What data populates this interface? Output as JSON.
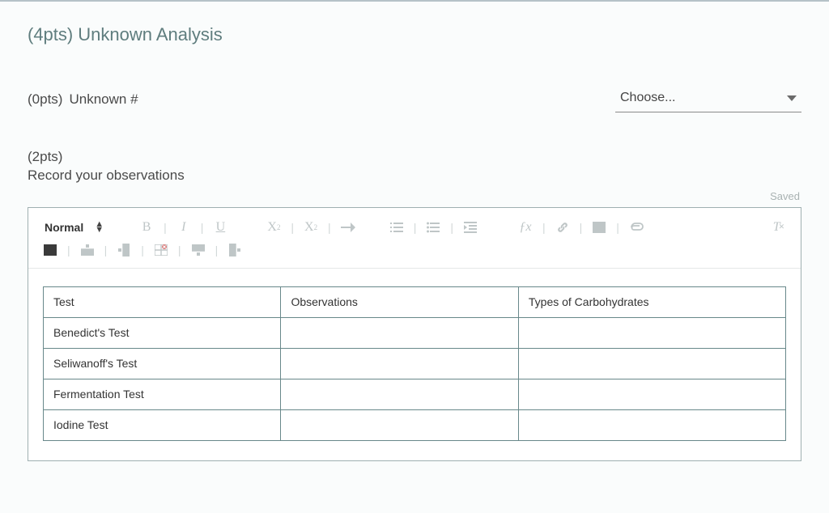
{
  "section": {
    "pts": "(4pts)",
    "title": "Unknown Analysis"
  },
  "q1": {
    "pts": "(0pts)",
    "label": "Unknown #",
    "dropdown_placeholder": "Choose..."
  },
  "q2": {
    "pts": "(2pts)",
    "label": "Record your observations",
    "saved": "Saved"
  },
  "toolbar": {
    "style": "Normal",
    "bold": "B",
    "italic": "I",
    "underline": "U",
    "sub": "X",
    "sup": "X",
    "fx": "ƒx",
    "clear": "T"
  },
  "table": {
    "headers": [
      "Test",
      "Observations",
      "Types of Carbohydrates"
    ],
    "rows": [
      [
        "Benedict's Test",
        "",
        ""
      ],
      [
        "Seliwanoff's Test",
        "",
        ""
      ],
      [
        "Fermentation Test",
        "",
        ""
      ],
      [
        "Iodine Test",
        "",
        ""
      ]
    ]
  }
}
